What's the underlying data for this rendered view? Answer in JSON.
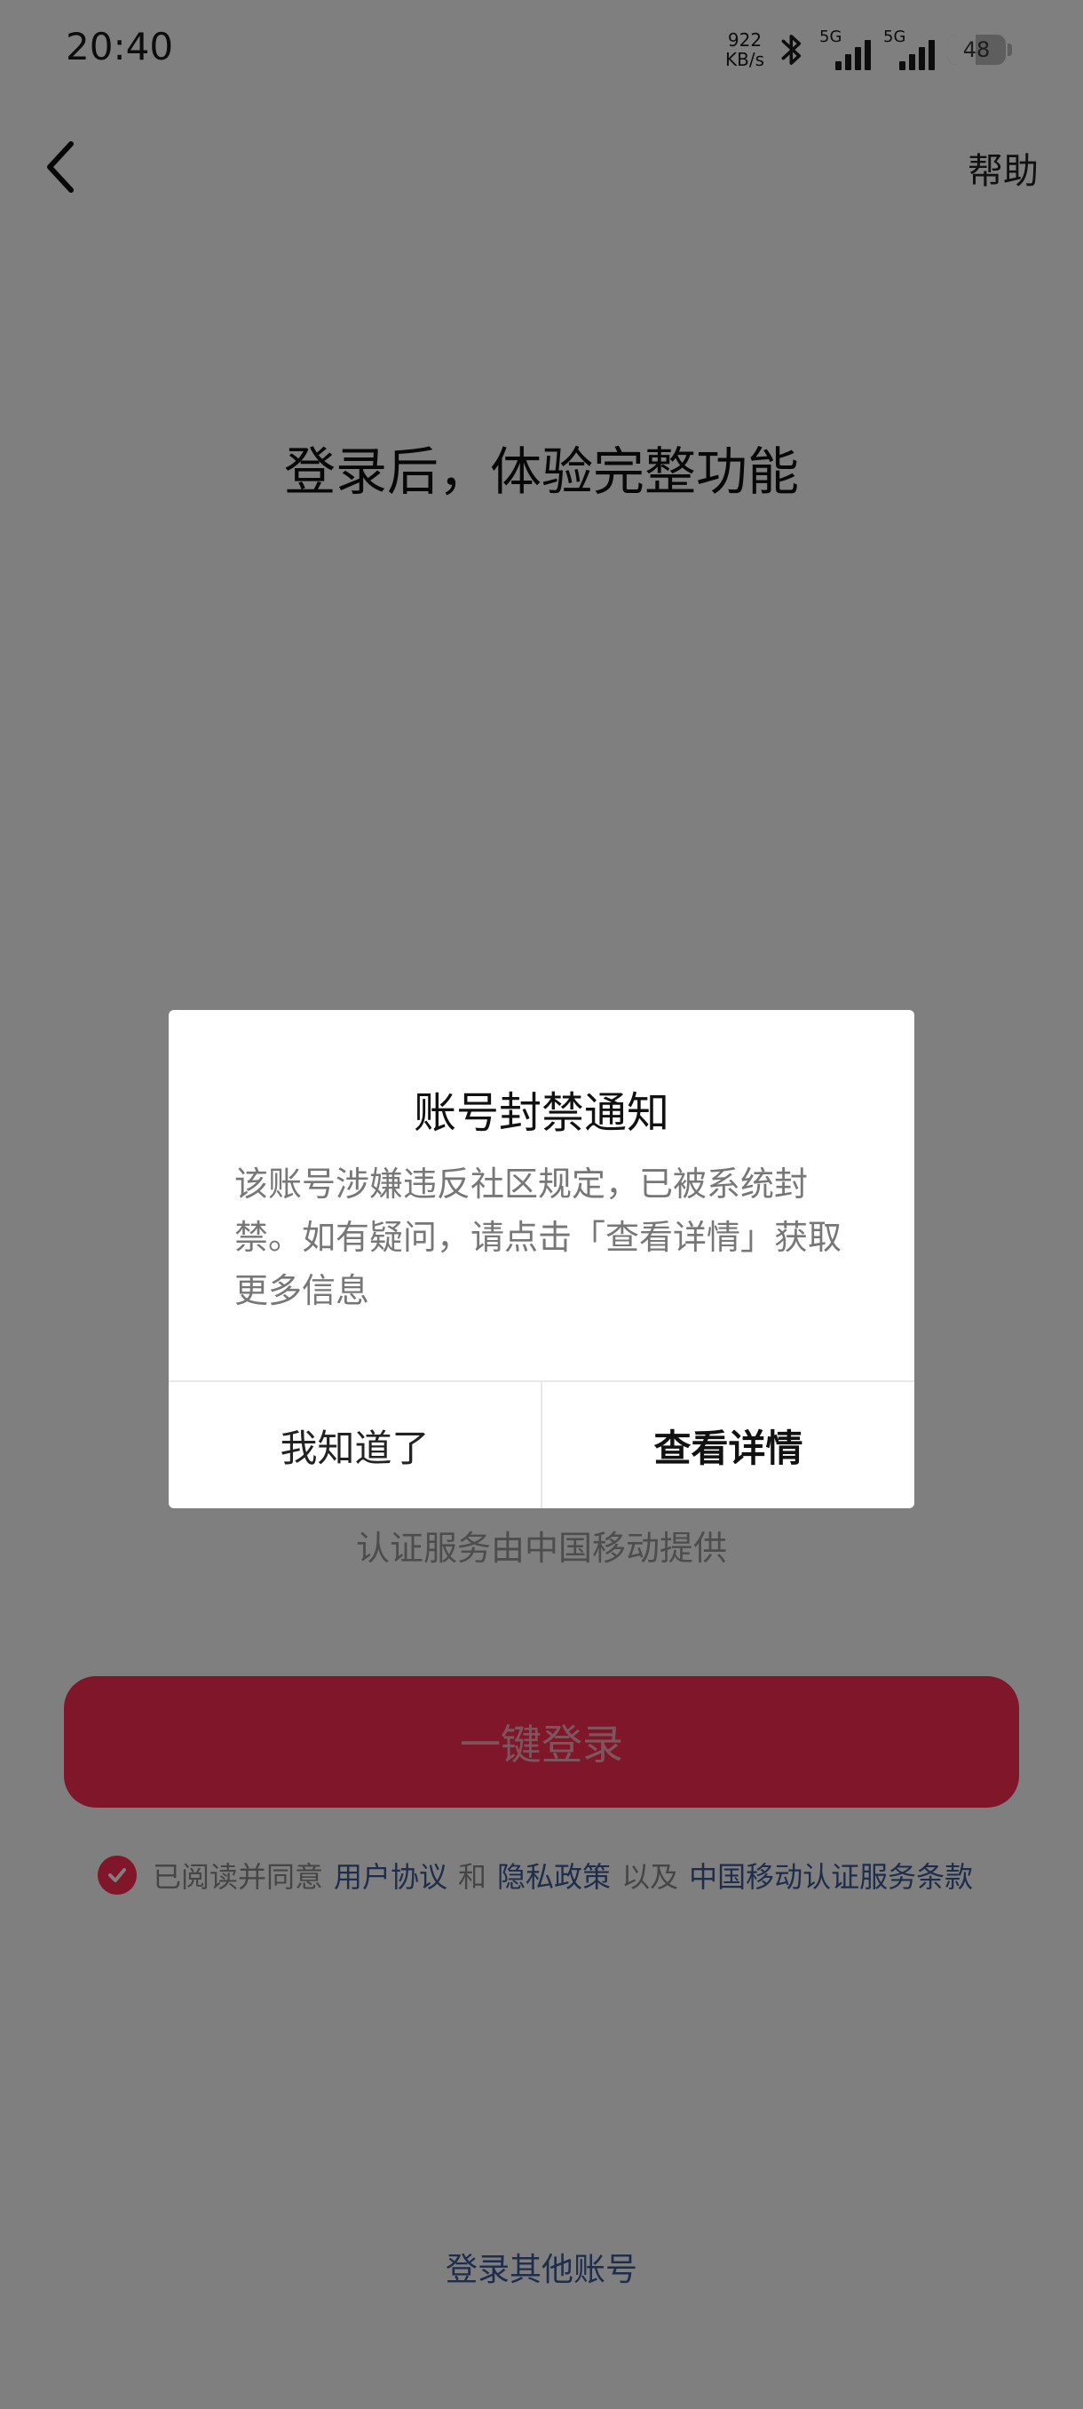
{
  "status_bar": {
    "time": "20:40",
    "net_speed_value": "922",
    "net_speed_unit": "KB/s",
    "sim1_label": "5G",
    "sim2_label": "5G",
    "battery_level": "48",
    "battery_percent": 48
  },
  "nav": {
    "help_label": "帮助"
  },
  "main": {
    "title": "登录后，体验完整功能",
    "auth_provider_text": "认证服务由中国移动提供",
    "login_button_label": "一键登录",
    "other_account_label": "登录其他账号"
  },
  "agreement": {
    "prefix": "已阅读并同意",
    "user_agreement": "用户协议",
    "and": "和",
    "privacy_policy": "隐私政策",
    "also": "以及",
    "cmcc_terms": "中国移动认证服务条款",
    "checked": true
  },
  "dialog": {
    "title": "账号封禁通知",
    "message": "该账号涉嫌违反社区规定，已被系统封禁。如有疑问，请点击「查看详情」获取更多信息",
    "dismiss_label": "我知道了",
    "details_label": "查看详情"
  },
  "colors": {
    "accent": "#fe2c55",
    "link": "#3d5a96",
    "overlay": "rgba(0,0,0,0.5)"
  }
}
